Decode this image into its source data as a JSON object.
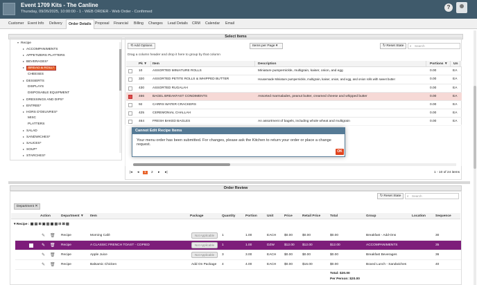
{
  "window": {
    "title": "Event 1709 Kits - The Canline",
    "subtitle": "Thursday, 09/26/2025, 10:00:00 - 1 - WEB ORDER - Web Order - Confirmed",
    "help_glyph": "?"
  },
  "tabs": [
    "Customer",
    "Event Info",
    "Delivery",
    "Order Details",
    "Proposal",
    "Financial",
    "Billing",
    "Changes",
    "Lead Details",
    "CRM",
    "Calendar",
    "Email"
  ],
  "select_items": {
    "header": "Select Items",
    "tree_root": "Recipe",
    "tree": [
      {
        "label": "ACCOMPANIMENTS",
        "arrow": "▸"
      },
      {
        "label": "APPETIZERS PLATTERS",
        "arrow": "▸"
      },
      {
        "label": "BEVERAGES*",
        "arrow": "▸"
      },
      {
        "label": "BREAD & ROLL*",
        "arrow": "▸",
        "selected": true
      },
      {
        "label": "CHEESES",
        "arrow": ""
      },
      {
        "label": "DESSERTS",
        "arrow": "▸"
      },
      {
        "label": "DISPLAYS",
        "arrow": ""
      },
      {
        "label": "DISPOSABLE EQUIPMENT",
        "arrow": ""
      },
      {
        "label": "DRESSINGS AND DIPS*",
        "arrow": "▸"
      },
      {
        "label": "ENTREE*",
        "arrow": "▸"
      },
      {
        "label": "HORS D'OEUVRES*",
        "arrow": "▸"
      },
      {
        "label": "MISC",
        "arrow": ""
      },
      {
        "label": "PLATTERS",
        "arrow": ""
      },
      {
        "label": "SALAD",
        "arrow": "▸"
      },
      {
        "label": "SANDWICHES*",
        "arrow": "▸"
      },
      {
        "label": "SAUCES*",
        "arrow": "▸"
      },
      {
        "label": "SOUP*",
        "arrow": "▸"
      },
      {
        "label": "STARCHES*",
        "arrow": "▸"
      }
    ],
    "add_button": "Add Options",
    "per_page": "Items per Page",
    "reset_state": "Reset State",
    "search_placeholder": "Search",
    "group_hint": "Drag a column header and drop it here to group by that column",
    "columns": [
      "Pk",
      "Item",
      "Description",
      "Portions",
      "Un"
    ],
    "rows": [
      {
        "pk": "10",
        "item": "ASSORTED MINIATURE ROLLS",
        "desc": "Miniature pumpernickle, multigrain, kaiser, onion, and egg",
        "portions": "0.00",
        "unit": "EA",
        "checked": false
      },
      {
        "pk": "320",
        "item": "ASSORTED PETITE ROLLS & WHIPPED BUTTER",
        "desc": "Housemade Miniature pumpernickle, multigrain, kaiser, onion, and egg, and onion rolls with sweet butter",
        "portions": "0.00",
        "unit": "EA",
        "checked": false
      },
      {
        "pk": "430",
        "item": "ASSORTED RUGALAH",
        "desc": "",
        "portions": "0.00",
        "unit": "EA",
        "checked": false
      },
      {
        "pk": "466",
        "item": "BAGEL BREAKFAST CONDIMENTS",
        "desc": "Assorted marmalades, peanut butter, creamed cheese and whipped butter",
        "portions": "0.00",
        "unit": "EA",
        "checked": true
      },
      {
        "pk": "92",
        "item": "CARRS WATER CRACKERS",
        "desc": "",
        "portions": "0.00",
        "unit": "EA",
        "checked": false
      },
      {
        "pk": "425",
        "item": "CEREMONIAL CHALLAH",
        "desc": "",
        "portions": "0.00",
        "unit": "EA",
        "checked": false
      },
      {
        "pk": "464",
        "item": "FRESH BAKED BAGLES",
        "desc": "An assortment of bagels, including whole wheat and multigrain",
        "portions": "0.00",
        "unit": "EA",
        "checked": false
      }
    ],
    "pager_pages": [
      "1",
      "2"
    ],
    "pager_summary": "1 - 10 of 24 items"
  },
  "modal": {
    "title": "Cannot Edit Recipe Items",
    "message": "Your menu order has been submitted. For changes, please ask the Kitchen to return your order or place a change request.",
    "ok": "OK"
  },
  "order_review": {
    "header": "Order Review",
    "reset_state": "Reset State",
    "search_placeholder": "Search",
    "group_chip": "Department",
    "columns": [
      "Action",
      "Department",
      "Item",
      "Package",
      "Quantity",
      "Portion",
      "Unit",
      "Price",
      "Retail Price",
      "Total",
      "Group",
      "Location",
      "Sequence"
    ],
    "group_label": "Recipe :",
    "rows": [
      {
        "dept": "Recipe",
        "item": "Morning Café",
        "package": "Not Applicable",
        "qty": "1",
        "portion": "1.00",
        "unit": "EACH",
        "price": "$0.00",
        "retail": "$0.00",
        "total": "$0.00",
        "group": "Breakfast - Add-Ons",
        "seq": "30",
        "selected": false
      },
      {
        "dept": "Recipe",
        "item": "A CLASSIC FRENCH TOAST - COPIED",
        "package": "Not Applicable",
        "qty": "1",
        "portion": "1.00",
        "unit": "DZW",
        "price": "$12.00",
        "retail": "$12.00",
        "total": "$12.00",
        "group": "ACCOMPANIMENTS",
        "seq": "35",
        "selected": true
      },
      {
        "dept": "Recipe",
        "item": "Apple Juice",
        "package": "Not Applicable",
        "qty": "3",
        "portion": "3.00",
        "unit": "EACH",
        "price": "$0.00",
        "retail": "$0.00",
        "total": "$0.00",
        "group": "Breakfast Beverages",
        "seq": "36",
        "selected": false
      },
      {
        "dept": "Recipe",
        "item": "Balsamic Chicken",
        "package": "Add On Package",
        "qty": "4",
        "portion": "4.00",
        "unit": "EACH",
        "price": "$0.00",
        "retail": "$16.00",
        "total": "$0.00",
        "group": "Boxed Lunch - Sandwiches",
        "seq": "40",
        "selected": false
      }
    ],
    "total": "Total: $20.00",
    "per_person": "Per Person: $20.00"
  }
}
